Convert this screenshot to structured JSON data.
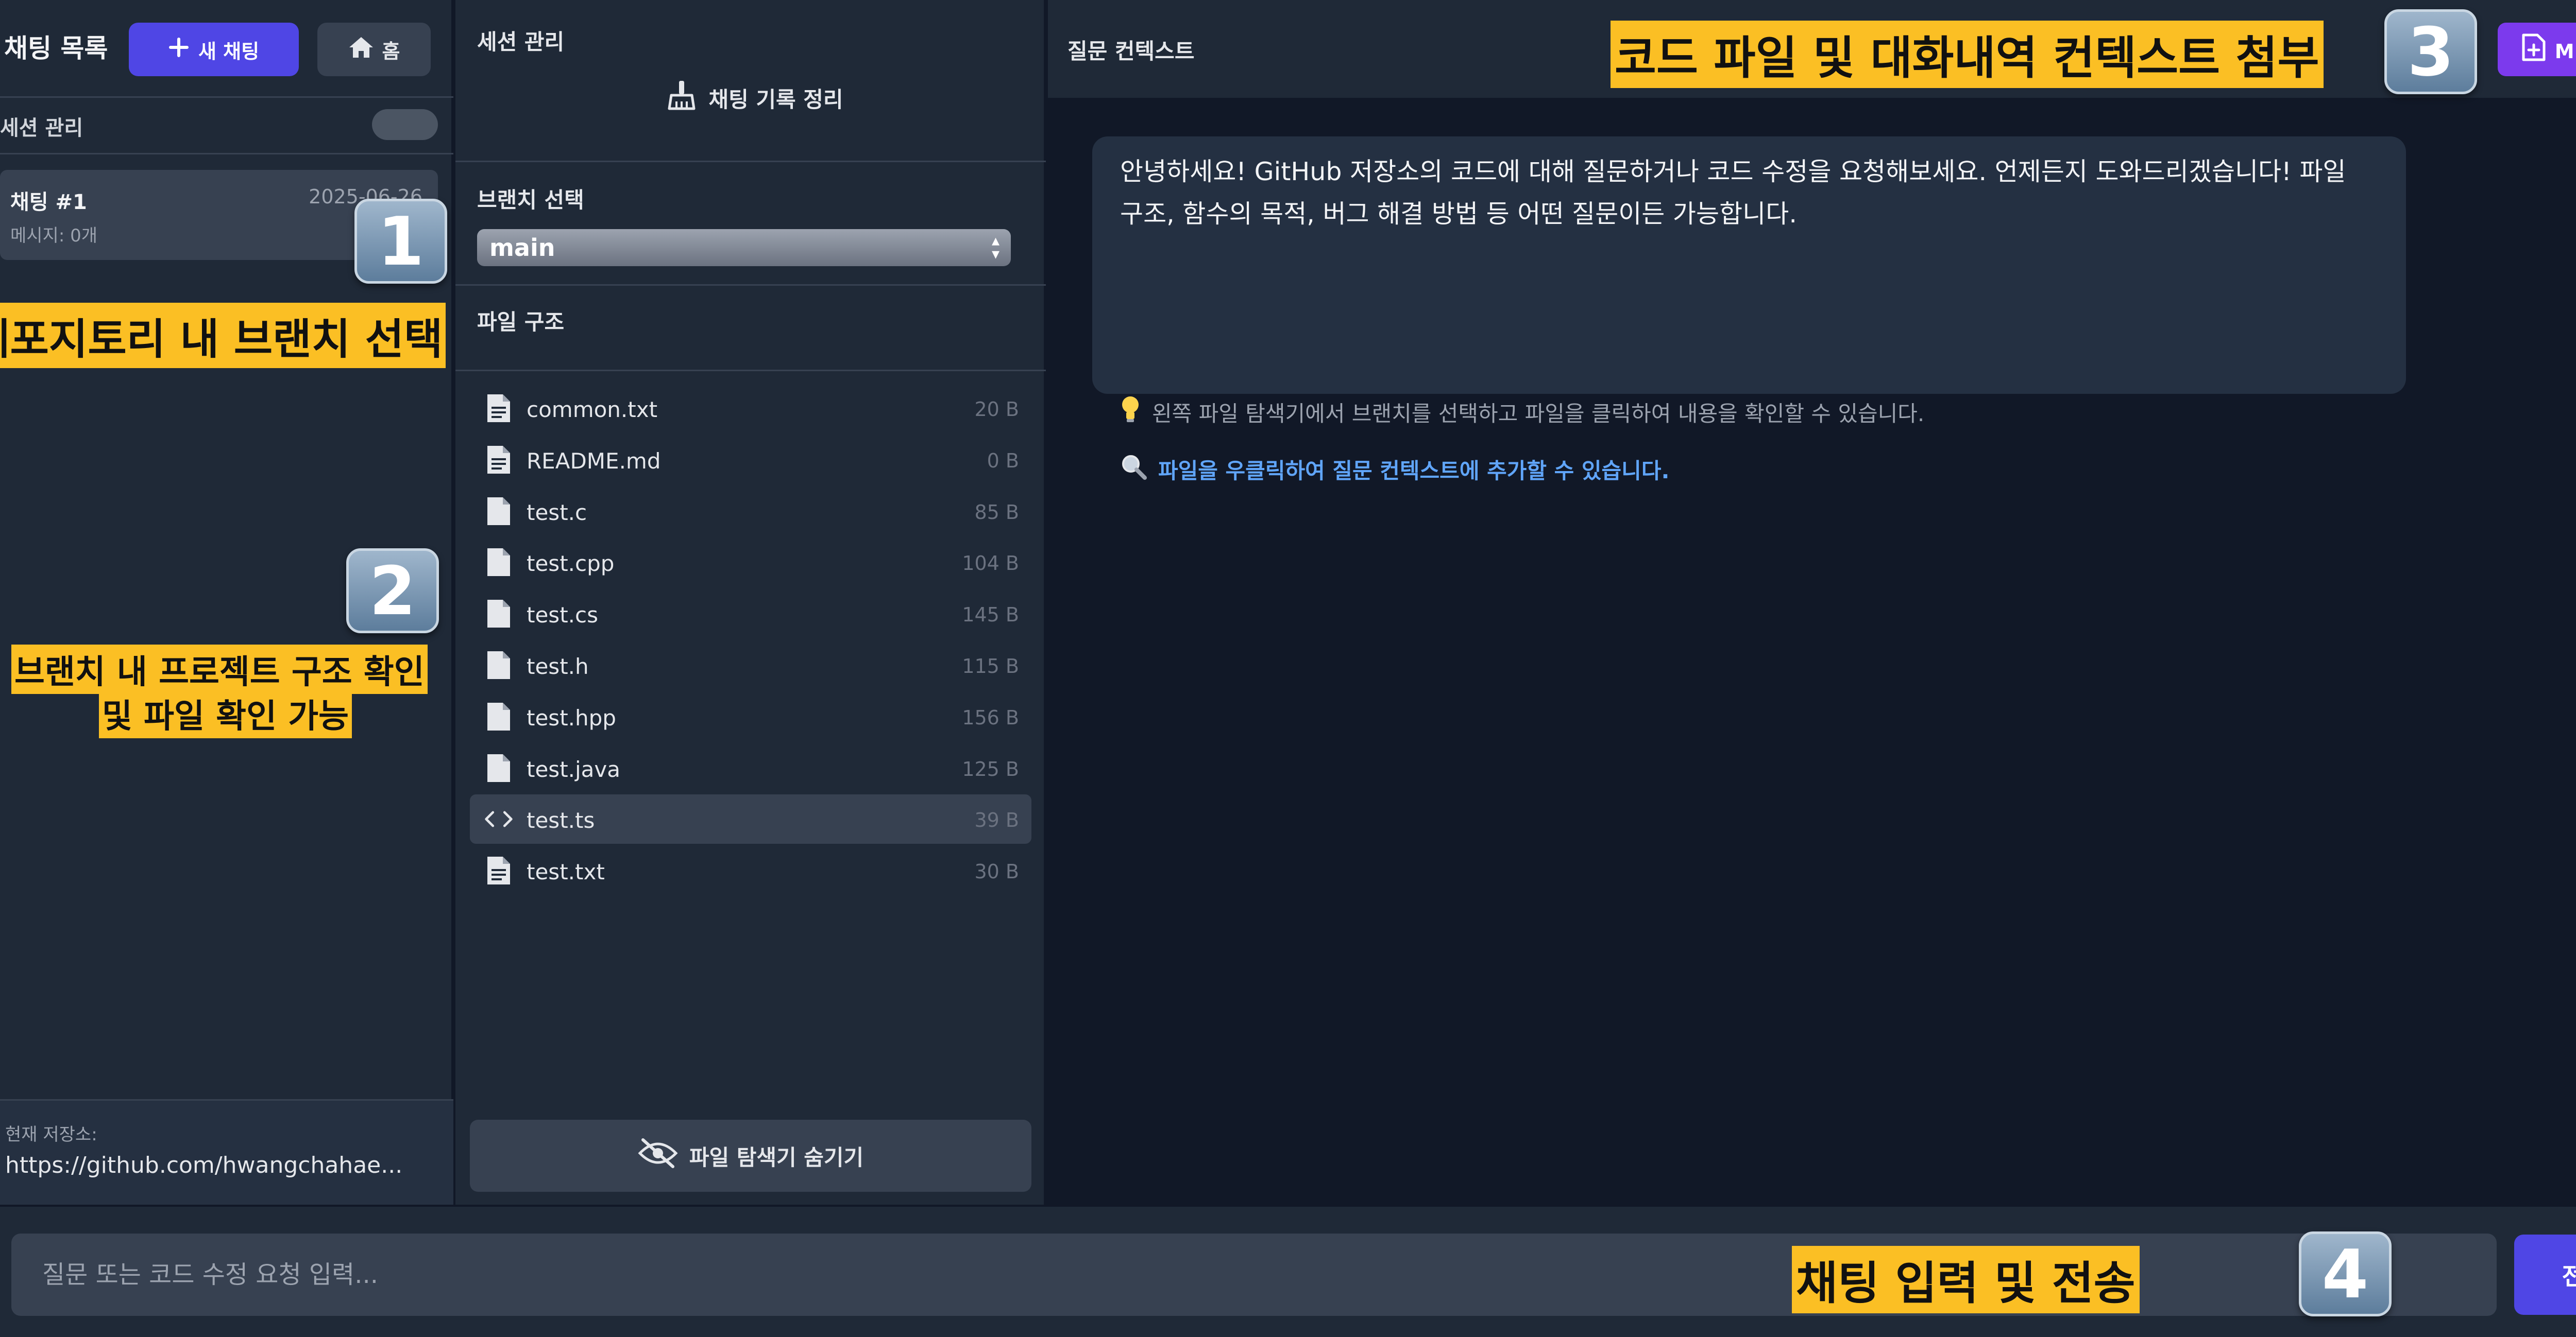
{
  "chat_panel": {
    "title": "채팅 목록",
    "new_chat_label": "새 채팅",
    "home_label": "홈",
    "session_label": "세션 관리",
    "chats": [
      {
        "name": "채팅 #1",
        "date": "2025-06-26",
        "meta": "메시지: 0개"
      }
    ],
    "repo_label": "현재 저장소:",
    "repo_url": "https://github.com/hwangchahae..."
  },
  "file_panel": {
    "session_title": "세션 관리",
    "clear_history_label": "채팅 기록 정리",
    "branch_title": "브랜치 선택",
    "branch_selected": "main",
    "tree_title": "파일 구조",
    "files": [
      {
        "name": "common.txt",
        "size": "20 B",
        "icon": "text-file-icon"
      },
      {
        "name": "README.md",
        "size": "0 B",
        "icon": "text-file-icon"
      },
      {
        "name": "test.c",
        "size": "85 B",
        "icon": "file-icon"
      },
      {
        "name": "test.cpp",
        "size": "104 B",
        "icon": "file-icon"
      },
      {
        "name": "test.cs",
        "size": "145 B",
        "icon": "file-icon"
      },
      {
        "name": "test.h",
        "size": "115 B",
        "icon": "file-icon"
      },
      {
        "name": "test.hpp",
        "size": "156 B",
        "icon": "file-icon"
      },
      {
        "name": "test.java",
        "size": "125 B",
        "icon": "file-icon"
      },
      {
        "name": "test.ts",
        "size": "39 B",
        "icon": "code-icon"
      },
      {
        "name": "test.txt",
        "size": "30 B",
        "icon": "text-file-icon"
      }
    ],
    "hide_explorer_label": "파일 탐색기 숨기기"
  },
  "chat_view": {
    "title": "질문 컨텍스트",
    "md_add_label": "MD 추가",
    "welcome_text": "안녕하세요! GitHub 저장소의 코드에 대해 질문하거나 코드 수정을 요청해보세요. 언제든지 도와드리겠습니다! 파일 구조, 함수의 목적, 버그 해결 방법 등 어떤 질문이든 가능합니다.",
    "tip_1": "왼쪽 파일 탐색기에서 브랜치를 선택하고 파일을 클릭하여 내용을 확인할 수 있습니다.",
    "tip_2": "파일을 우클릭하여 질문 컨텍스트에 추가할 수 있습니다."
  },
  "input_bar": {
    "placeholder": "질문 또는 코드 수정 요청 입력...",
    "send_label": "전송"
  },
  "annotations": [
    {
      "number": "1",
      "text": "레포지토리 내 브랜치 선택"
    },
    {
      "number": "2",
      "text_line1": "브랜치 내 프로젝트 구조 확인",
      "text_line2": "및 파일 확인 가능"
    },
    {
      "number": "3",
      "text": "코드 파일 및 대화내역 컨텍스트 첨부"
    },
    {
      "number": "4",
      "text": "채팅 입력 및 전송"
    }
  ],
  "colors": {
    "accent": "#4f46e5",
    "md_button": "#7c3aed",
    "panel": "#1f2937",
    "background": "#111827",
    "callout": "#fbbf24",
    "link": "#60a5fa"
  }
}
